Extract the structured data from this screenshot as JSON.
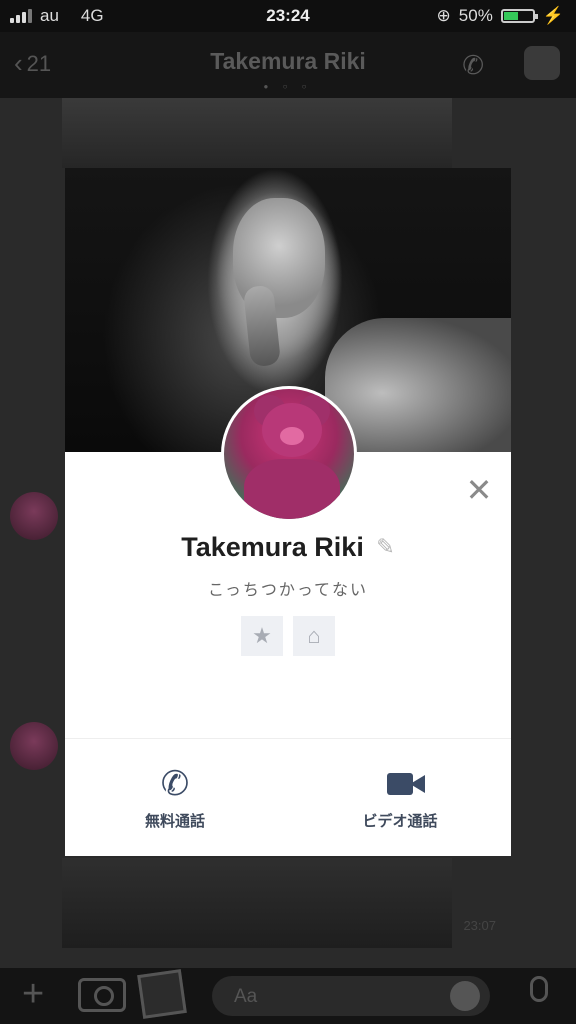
{
  "status_bar": {
    "carrier": "au",
    "network": "4G",
    "time": "23:24",
    "battery": "50%",
    "battery_level": 0.5
  },
  "nav": {
    "back_count": "21",
    "title": "Takemura Riki"
  },
  "chat": {
    "timestamp": "23:07"
  },
  "input": {
    "placeholder": "Aa"
  },
  "profile": {
    "name": "Takemura Riki",
    "status_message": "こっちつかってない",
    "actions": [
      {
        "label": "無料通話",
        "icon": "phone-icon"
      },
      {
        "label": "ビデオ通話",
        "icon": "video-camera-icon"
      }
    ]
  },
  "colors": {
    "accent_navy": "#3b4b66",
    "battery_green": "#35c759"
  }
}
